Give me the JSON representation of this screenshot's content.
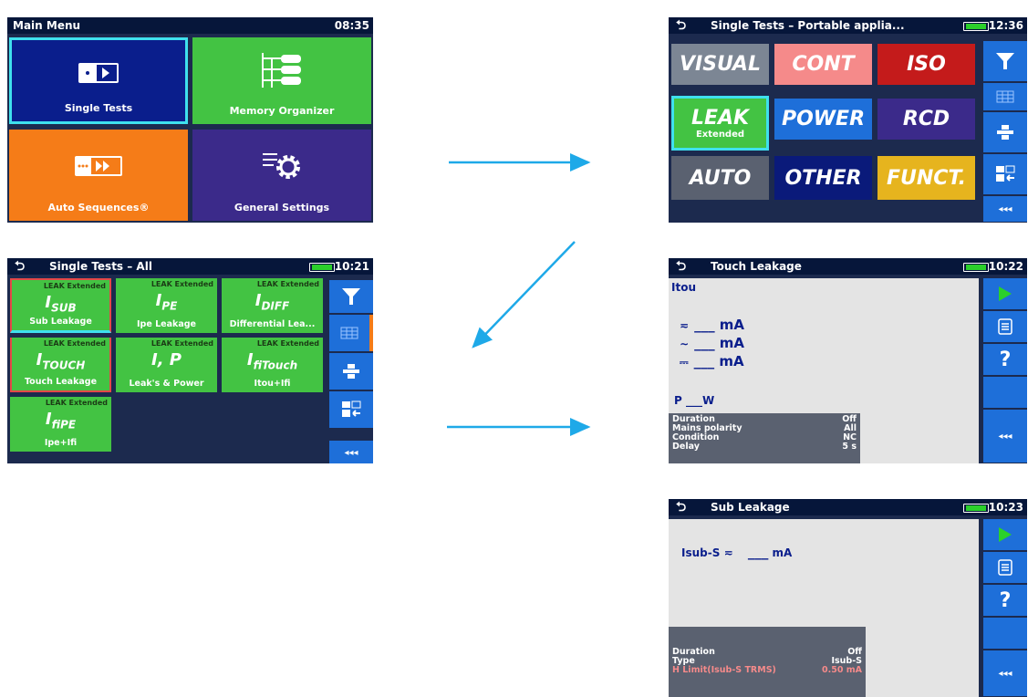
{
  "main_menu": {
    "title": "Main Menu",
    "time": "08:35",
    "tiles": [
      {
        "label": "Single Tests",
        "icon": "single-tests-icon",
        "color": "#0a1e8c"
      },
      {
        "label": "Memory Organizer",
        "icon": "memory-organizer-icon",
        "color": "#43c343"
      },
      {
        "label": "Auto Sequences®",
        "icon": "auto-sequences-icon",
        "color": "#f57c18"
      },
      {
        "label": "General Settings",
        "icon": "gear-icon",
        "color": "#3b2a8a"
      }
    ]
  },
  "portable": {
    "title": "Single Tests – Portable applia...",
    "time": "12:36",
    "tiles": [
      {
        "label": "VISUAL",
        "color": "#7c8694"
      },
      {
        "label": "CONT",
        "color": "#f58a8a"
      },
      {
        "label": "ISO",
        "color": "#c41b1b"
      },
      {
        "label": "LEAK",
        "sublabel": "Extended",
        "color": "#43c343"
      },
      {
        "label": "POWER",
        "color": "#1e6fd9"
      },
      {
        "label": "RCD",
        "color": "#3b2a8a"
      },
      {
        "label": "AUTO",
        "color": "#5a6170"
      },
      {
        "label": "OTHER",
        "color": "#0a1a7a"
      },
      {
        "label": "FUNCT.",
        "color": "#e6b41e"
      }
    ],
    "sidebar_more": "◂◂◂"
  },
  "all": {
    "title": "Single Tests – All",
    "time": "10:21",
    "tiles": [
      {
        "header": "LEAK Extended",
        "symbol": "I",
        "symbol_sub": "SUB",
        "label": "Sub Leakage"
      },
      {
        "header": "LEAK Extended",
        "symbol": "I",
        "symbol_sub": "PE",
        "label": "Ipe Leakage"
      },
      {
        "header": "LEAK Extended",
        "symbol": "I",
        "symbol_sub": "DIFF",
        "label": "Differential Lea..."
      },
      {
        "header": "LEAK Extended",
        "symbol": "I",
        "symbol_sub": "TOUCH",
        "label": "Touch Leakage"
      },
      {
        "header": "LEAK Extended",
        "symbol": "I, P",
        "symbol_sub": "",
        "label": "Leak's & Power"
      },
      {
        "header": "LEAK Extended",
        "symbol": "I",
        "symbol_sub": "fiTouch",
        "label": "Itou+Ifi"
      },
      {
        "header": "LEAK Extended",
        "symbol": "I",
        "symbol_sub": "fiPE",
        "label": "Ipe+Ifi"
      }
    ],
    "sidebar_more": "◂◂◂"
  },
  "touch": {
    "title": "Touch Leakage",
    "time": "10:22",
    "result_label": "Itou",
    "readings": [
      {
        "symbol": "≂",
        "value": "___",
        "unit": "mA"
      },
      {
        "symbol": "∼",
        "value": "___",
        "unit": "mA"
      },
      {
        "symbol": "⎓",
        "value": "___",
        "unit": "mA"
      }
    ],
    "power_label": "P",
    "power_value": "___",
    "power_unit": "W",
    "params": [
      {
        "name": "Duration",
        "value": "Off"
      },
      {
        "name": "Mains polarity",
        "value": "All"
      },
      {
        "name": "Condition",
        "value": "NC"
      },
      {
        "name": "Delay",
        "value": "5 s"
      }
    ],
    "sidebar_more": "◂◂◂"
  },
  "sub": {
    "title": "Sub Leakage",
    "time": "10:23",
    "reading_label": "Isub-S",
    "reading_symbol": "≂",
    "reading_value": "___",
    "reading_unit": "mA",
    "params": [
      {
        "name": "Duration",
        "value": "Off",
        "color": "#ffffff"
      },
      {
        "name": "Type",
        "value": "Isub-S",
        "color": "#ffffff"
      },
      {
        "name": "H Limit(Isub-S TRMS)",
        "value": "0.50 mA",
        "color": "#f58a8a"
      }
    ],
    "sidebar_more": "◂◂◂"
  },
  "colors": {
    "arrow": "#1ea9e8",
    "selection": "#3fe0ee",
    "highlight": "#e44848"
  }
}
